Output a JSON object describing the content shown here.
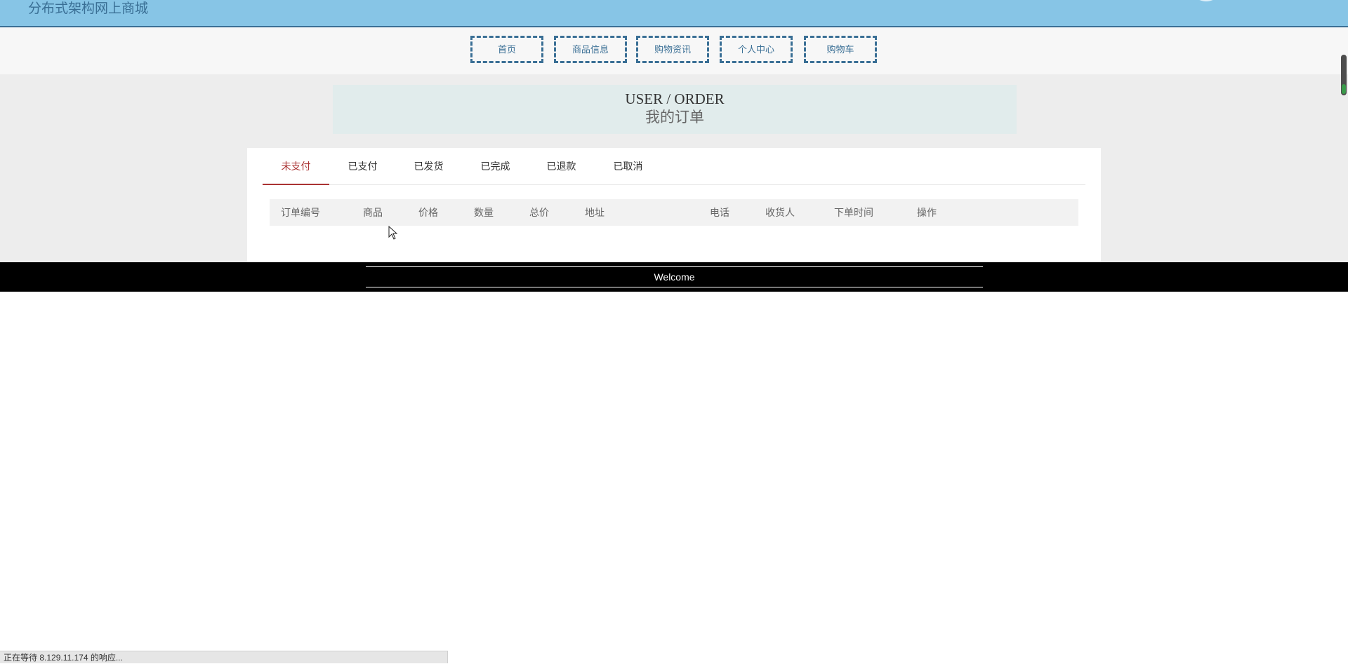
{
  "header": {
    "title": "分布式架构网上商城"
  },
  "nav": {
    "items": [
      {
        "label": "首页"
      },
      {
        "label": "商品信息"
      },
      {
        "label": "购物资讯"
      },
      {
        "label": "个人中心"
      },
      {
        "label": "购物车"
      }
    ]
  },
  "page_heading": {
    "en": "USER / ORDER",
    "cn": "我的订单"
  },
  "tabs": [
    {
      "label": "未支付",
      "active": true
    },
    {
      "label": "已支付"
    },
    {
      "label": "已发货"
    },
    {
      "label": "已完成"
    },
    {
      "label": "已退款"
    },
    {
      "label": "已取消"
    }
  ],
  "table": {
    "columns": [
      "订单编号",
      "商品",
      "价格",
      "数量",
      "总价",
      "地址",
      "电话",
      "收货人",
      "下单时间",
      "操作"
    ],
    "rows": []
  },
  "footer": {
    "text": "Welcome"
  },
  "status_bar": {
    "text": "正在等待 8.129.11.174 的响应..."
  },
  "colors": {
    "header_bg": "#87c5e6",
    "brand_text": "#3a6f95",
    "active_tab": "#aa3333",
    "footer_bg": "#000000"
  }
}
